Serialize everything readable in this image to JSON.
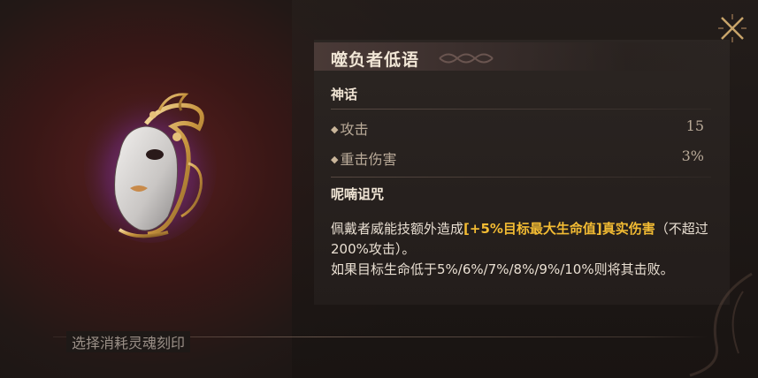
{
  "item": {
    "name": "噬负者低语",
    "rarity": "神话",
    "stats": [
      {
        "label": "攻击",
        "value": "15"
      },
      {
        "label": "重击伤害",
        "value": "3%"
      }
    ],
    "curse": {
      "title": "呢喃诅咒",
      "desc_prefix": "佩戴者威能技额外造成",
      "desc_highlight": "[+5%目标最大生命值]真实伤害",
      "desc_mid": "（不超过200%攻击）。",
      "desc_suffix": "如果目标生命低于5%/6%/7%/8%/9%/10%则将其击败。"
    },
    "icon": "porcelain-mask-icon"
  },
  "footer": {
    "label": "选择消耗灵魂刻印"
  },
  "close_icon": "close-icon",
  "colors": {
    "highlight": "#f2bb33",
    "title": "#f1e6d6",
    "stat_text": "#b9aa98"
  }
}
